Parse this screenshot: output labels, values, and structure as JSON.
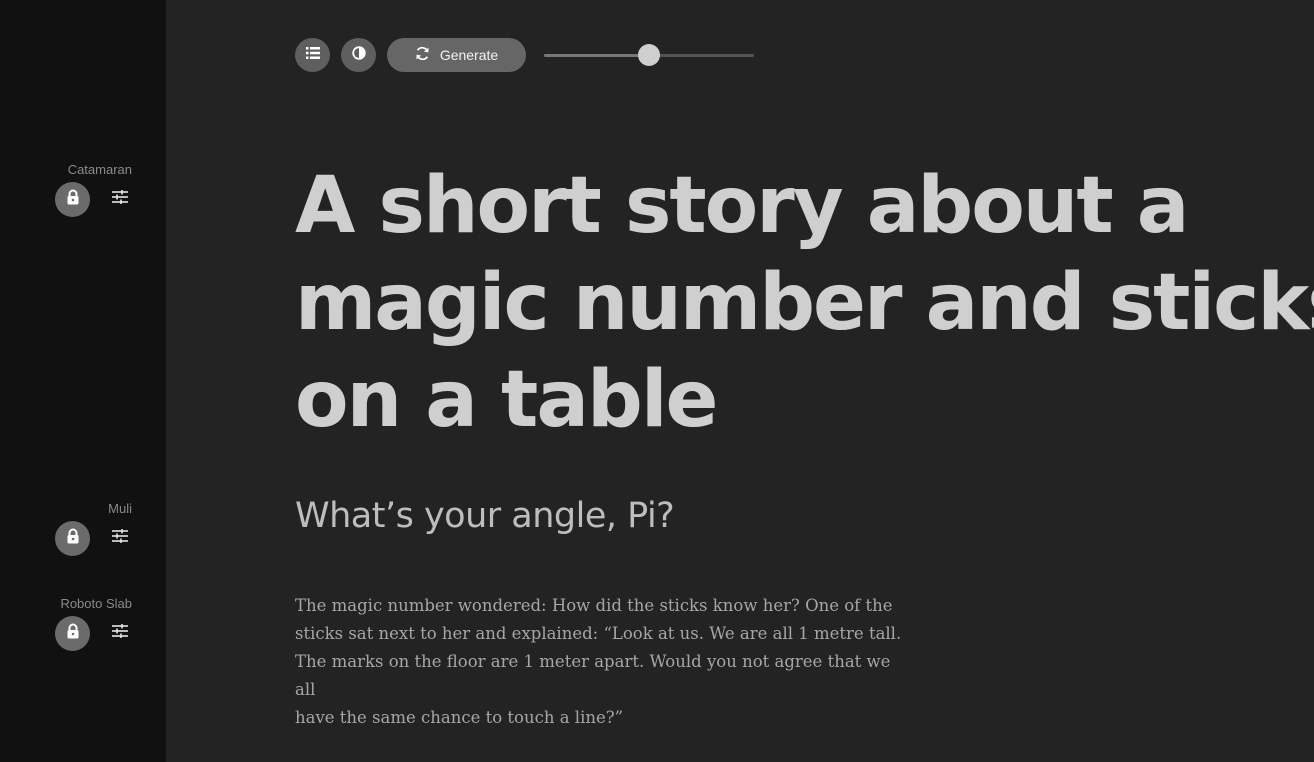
{
  "sidebar": {
    "fonts": [
      {
        "name": "Catamaran",
        "lock_icon": "lock-icon",
        "tune_icon": "sliders-icon"
      },
      {
        "name": "Muli",
        "lock_icon": "lock-icon",
        "tune_icon": "sliders-icon"
      },
      {
        "name": "Roboto Slab",
        "lock_icon": "lock-icon",
        "tune_icon": "sliders-icon"
      }
    ]
  },
  "toolbar": {
    "list_icon": "list-icon",
    "contrast_icon": "contrast-icon",
    "generate_icon": "refresh-icon",
    "generate_label": "Generate",
    "slider_level": 0.5
  },
  "content": {
    "headline_lines": [
      "A short story about a",
      "magic number and sticks",
      "on a table"
    ],
    "subhead": "What’s your angle, Pi?",
    "body_lines": [
      "The magic number wondered: How did the sticks know her? One of the",
      "sticks sat next to her and explained: “Look at us. We are all 1 metre tall.",
      "The marks on the floor are 1 meter apart. Would you not agree that we all",
      "have the same chance to touch a line?”"
    ]
  },
  "colors": {
    "sidebar_bg": "#111111",
    "main_bg": "#232323",
    "headline": "#cfcfcf",
    "button_bg": "#5f5f5f"
  }
}
